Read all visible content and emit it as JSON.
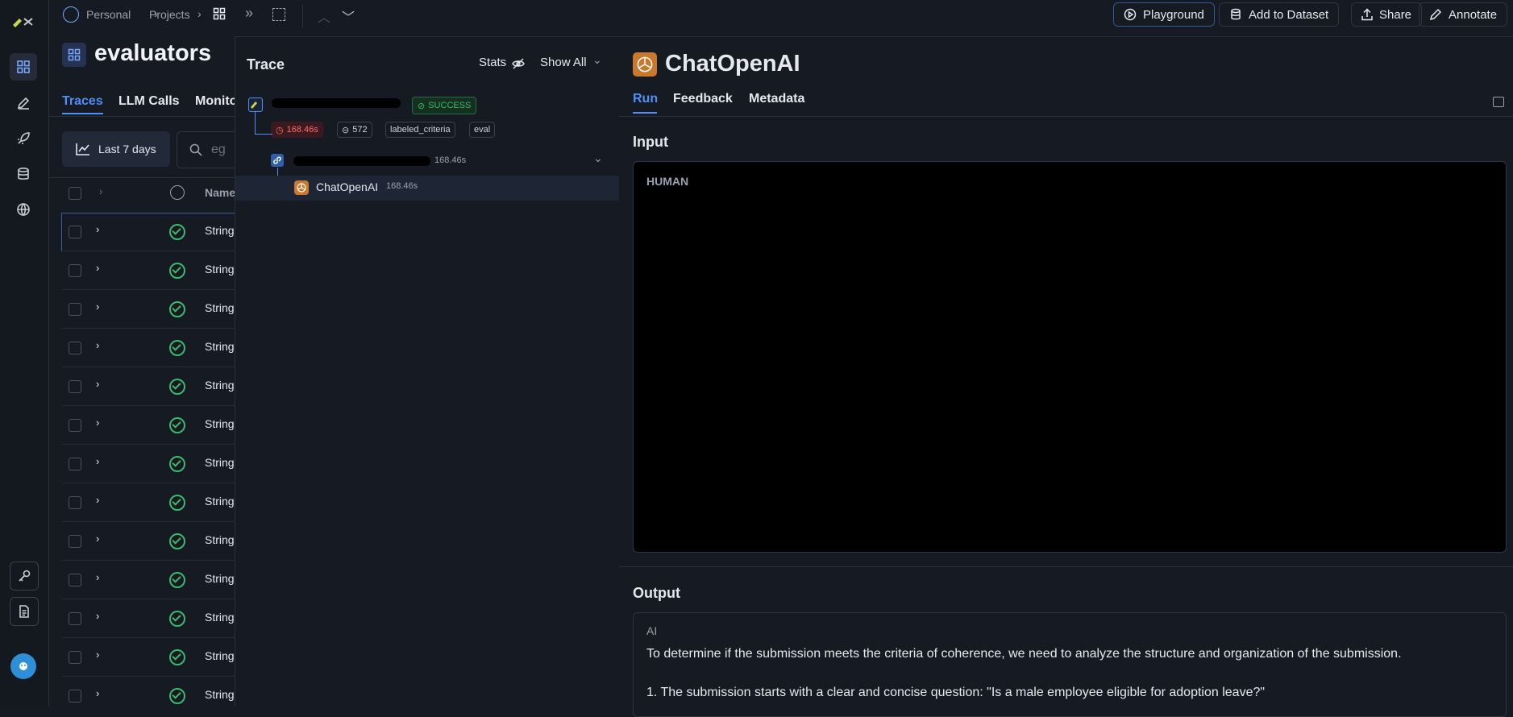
{
  "breadcrumb": {
    "personal": "Personal",
    "projects": "Projects"
  },
  "project": {
    "title": "evaluators",
    "tabs": [
      "Traces",
      "LLM Calls",
      "Monito"
    ],
    "date_filter": "Last 7 days",
    "search_placeholder": "eg",
    "column_name": "Name",
    "rows": [
      "String",
      "String",
      "String",
      "String",
      "String",
      "String",
      "String",
      "String",
      "String",
      "String",
      "String",
      "String",
      "String"
    ]
  },
  "toolbar": {
    "playground": "Playground",
    "add_to_dataset": "Add to Dataset",
    "share": "Share",
    "annotate": "Annotate"
  },
  "trace": {
    "title": "Trace",
    "stats": "Stats",
    "show_all": "Show All",
    "status": "SUCCESS",
    "latency": "168.46s",
    "tokens": "572",
    "tags": [
      "labeled_criteria",
      "eval"
    ],
    "chain_latency": "168.46s",
    "llm_name": "ChatOpenAI",
    "llm_latency": "168.46s"
  },
  "run": {
    "title": "ChatOpenAI",
    "tabs": [
      "Run",
      "Feedback",
      "Metadata"
    ],
    "input_label": "Input",
    "human_label": "HUMAN",
    "output_label": "Output",
    "ai_label": "AI",
    "output_line1": "To determine if the submission meets the criteria of coherence, we need to analyze the structure and organization of the submission.",
    "output_line2": "1. The submission starts with a clear and concise question: \"Is a male employee eligible for adoption leave?\""
  },
  "colors": {
    "accent": "#4f8ff7",
    "success": "#3fb868",
    "danger": "#e5484d",
    "openai": "#c9782c"
  }
}
